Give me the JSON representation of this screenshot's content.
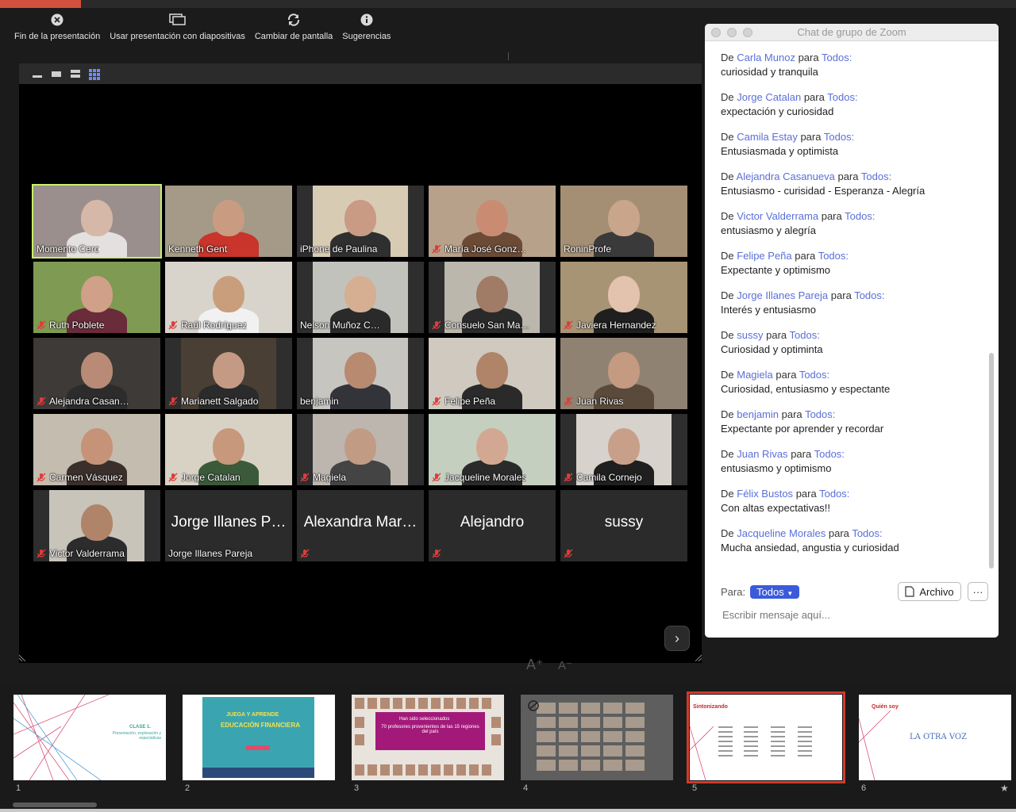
{
  "toolbar": {
    "end_label": "Fin de la presentación",
    "use_slideshow_label": "Usar presentación con diapositivas",
    "swap_label": "Cambiar de pantalla",
    "tips_label": "Sugerencias"
  },
  "participants": [
    {
      "name": "Momento Cero",
      "muted": false,
      "active": true,
      "bg": "#9a8f8c",
      "skin": "#d6b8a8",
      "shirt": "#e5e0e0"
    },
    {
      "name": "Kenneth Gent",
      "muted": false,
      "bg": "#a49a87",
      "skin": "#c99c82",
      "shirt": "#c9342b"
    },
    {
      "name": "iPhone de Paulina",
      "muted": false,
      "bg": "#d7cbb3",
      "skin": "#c99a84",
      "shirt": "#2f2f2f"
    },
    {
      "name": "María José Gonz…",
      "muted": true,
      "bg": "#b8a18a",
      "skin": "#c98c73",
      "shirt": "#6c4b36"
    },
    {
      "name": "RoninProfe",
      "muted": false,
      "bg": "#a48f74",
      "skin": "#c9a58c",
      "shirt": "#3a3a3a"
    },
    {
      "name": "Ruth Poblete",
      "muted": true,
      "bg": "#7f9a52",
      "skin": "#d0a089",
      "shirt": "#6a2b3a"
    },
    {
      "name": "Raúl Rodríguez",
      "muted": true,
      "bg": "#d8d4cc",
      "skin": "#c99e7c",
      "shirt": "#f1f1f1"
    },
    {
      "name": "Nelson Muñoz C…",
      "muted": false,
      "bg": "#c2c2bd",
      "skin": "#d6ae92",
      "shirt": "#2a2a2a"
    },
    {
      "name": "Consuelo San Ma…",
      "muted": true,
      "bg": "#bcb7ad",
      "skin": "#a07b66",
      "shirt": "#2a2a2a"
    },
    {
      "name": "Javiera Hernandez",
      "muted": true,
      "bg": "#a79474",
      "skin": "#e3c2ae",
      "shirt": "#1f1f1f"
    },
    {
      "name": "Alejandra Casan…",
      "muted": true,
      "bg": "#3d3a37",
      "skin": "#b98b76",
      "shirt": "#2c2c2c"
    },
    {
      "name": "Marianett Salgado",
      "muted": true,
      "bg": "#4a3f35",
      "skin": "#c59a84",
      "shirt": "#2b2b2b"
    },
    {
      "name": "benjamin",
      "muted": false,
      "bg": "#c7c5c0",
      "skin": "#b88a70",
      "shirt": "#33343a"
    },
    {
      "name": "Felipe Peña",
      "muted": true,
      "bg": "#cfc9c0",
      "skin": "#b08468",
      "shirt": "#2a2a2a"
    },
    {
      "name": "Juan Rivas",
      "muted": true,
      "bg": "#8f8272",
      "skin": "#c49a80",
      "shirt": "#5a4a3c"
    },
    {
      "name": "Carmen Vásquez",
      "muted": true,
      "bg": "#c4bcae",
      "skin": "#c69378",
      "shirt": "#3a2f2a"
    },
    {
      "name": "Jorge Catalan",
      "muted": true,
      "bg": "#d8d2c5",
      "skin": "#c7987b",
      "shirt": "#3b5a3a"
    },
    {
      "name": "Magiela",
      "muted": true,
      "bg": "#bcb6ae",
      "skin": "#c29b85",
      "shirt": "#444"
    },
    {
      "name": "Jacqueline Morales",
      "muted": true,
      "bg": "#c5cfc0",
      "skin": "#d2a893",
      "shirt": "#2a2a2a"
    },
    {
      "name": "Camila Cornejo",
      "muted": true,
      "bg": "#d7d3cc",
      "skin": "#c8a08a",
      "shirt": "#1f1f1f"
    },
    {
      "name": "Victor Valderrama",
      "muted": true,
      "bg": "#c9c4ba",
      "skin": "#b08469",
      "shirt": "#2c2c2c"
    },
    {
      "name": "Jorge Illanes Pareja",
      "big": "Jorge Illanes P…",
      "muted": false,
      "novideo": true
    },
    {
      "name": "",
      "big": "Alexandra Mar…",
      "muted": true,
      "novideo": true
    },
    {
      "name": "",
      "big": "Alejandro",
      "muted": true,
      "novideo": true
    },
    {
      "name": "",
      "big": "sussy",
      "muted": true,
      "novideo": true
    }
  ],
  "chat": {
    "title": "Chat de grupo de Zoom",
    "from_word": "De",
    "to_word": "para",
    "messages": [
      {
        "sender": "Carla Munoz",
        "to": "Todos:",
        "text": "curiosidad y tranquila"
      },
      {
        "sender": "Jorge Catalan",
        "to": "Todos:",
        "text": "expectación y curiosidad"
      },
      {
        "sender": "Camila Estay ",
        "to": "Todos:",
        "text": "Entusiasmada y optimista"
      },
      {
        "sender": "Alejandra Casanueva",
        "to": "Todos:",
        "text": "Entusiasmo - curisidad - Esperanza - Alegría"
      },
      {
        "sender": "Victor Valderrama",
        "to": "Todos:",
        "text": "entusiasmo y alegría"
      },
      {
        "sender": "Felipe Peña",
        "to": "Todos:",
        "text": "Expectante y optimismo"
      },
      {
        "sender": "Jorge Illanes Pareja",
        "to": "Todos:",
        "text": "Interés y entusiasmo"
      },
      {
        "sender": "sussy",
        "to": "Todos:",
        "text": "Curiosidad y optiminta"
      },
      {
        "sender": "Magiela",
        "to": "Todos:",
        "text": "Curiosidad, entusiasmo y espectante"
      },
      {
        "sender": "benjamin",
        "to": "Todos:",
        "text": "Expectante por aprender y recordar"
      },
      {
        "sender": "Juan Rivas",
        "to": "Todos:",
        "text": "entusiasmo y optimismo"
      },
      {
        "sender": "Félix Bustos",
        "to": "Todos:",
        "text": "Con altas expectativas!!"
      },
      {
        "sender": "Jacqueline Morales",
        "to": "Todos:",
        "text": "Mucha ansiedad, angustia y curiosidad"
      }
    ],
    "to_label": "Para:",
    "recipient": "Todos",
    "file_label": "Archivo",
    "more_label": "···",
    "input_placeholder": "Escribir mensaje aquí..."
  },
  "slides": [
    {
      "num": "1",
      "title": "CLASE 1.",
      "subtitle": "Presentación, exploración y expectativas"
    },
    {
      "num": "2",
      "title": "JUEGA Y APRENDE",
      "subtitle": "EDUCACIÓN FINANCIERA"
    },
    {
      "num": "3",
      "title": "Han sido seleccionados",
      "subtitle": "70 profesores provenientes de las 15 regiones del país"
    },
    {
      "num": "4"
    },
    {
      "num": "5",
      "title": "Sintonizando",
      "selected": true
    },
    {
      "num": "6",
      "title": "Quién soy",
      "subtitle": "LA OTRA VOZ"
    }
  ],
  "colors": {
    "accent_blue": "#3b5bdb",
    "active_speaker": "#c8f06a",
    "selected_slide": "#d23a2a",
    "mic_red": "#e23b3b"
  }
}
